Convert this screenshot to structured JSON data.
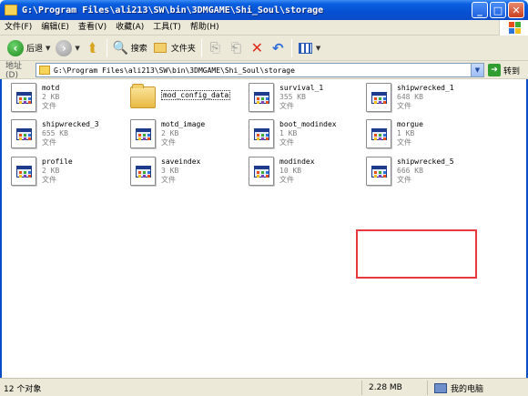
{
  "window": {
    "title": "G:\\Program Files\\ali213\\SW\\bin\\3DMGAME\\Shi_Soul\\storage",
    "controls": {
      "minimize": "_",
      "maximize": "□",
      "close": "✕"
    }
  },
  "menu": [
    "文件(F)",
    "编辑(E)",
    "查看(V)",
    "收藏(A)",
    "工具(T)",
    "帮助(H)"
  ],
  "toolbar": {
    "back_label": "后退",
    "search_label": "搜索",
    "folders_label": "文件夹"
  },
  "address": {
    "label": "地址(D)",
    "value": "G:\\Program Files\\ali213\\SW\\bin\\3DMGAME\\Shi_Soul\\storage",
    "go_label": "转到"
  },
  "files": [
    {
      "name": "motd",
      "size": "2 KB",
      "type": "文件",
      "kind": "file"
    },
    {
      "name": "mod_config_data",
      "size": "",
      "type": "",
      "kind": "folder"
    },
    {
      "name": "survival_1",
      "size": "355 KB",
      "type": "文件",
      "kind": "file"
    },
    {
      "name": "shipwrecked_1",
      "size": "648 KB",
      "type": "文件",
      "kind": "file"
    },
    {
      "name": "shipwrecked_3",
      "size": "655 KB",
      "type": "文件",
      "kind": "file"
    },
    {
      "name": "motd_image",
      "size": "2 KB",
      "type": "文件",
      "kind": "file"
    },
    {
      "name": "boot_modindex",
      "size": "1 KB",
      "type": "文件",
      "kind": "file"
    },
    {
      "name": "morgue",
      "size": "1 KB",
      "type": "文件",
      "kind": "file"
    },
    {
      "name": "profile",
      "size": "2 KB",
      "type": "文件",
      "kind": "file"
    },
    {
      "name": "saveindex",
      "size": "3 KB",
      "type": "文件",
      "kind": "file"
    },
    {
      "name": "modindex",
      "size": "10 KB",
      "type": "文件",
      "kind": "file"
    },
    {
      "name": "shipwrecked_5",
      "size": "666 KB",
      "type": "文件",
      "kind": "file"
    }
  ],
  "status": {
    "count": "12 个对象",
    "size": "2.28 MB",
    "location": "我的电脑"
  },
  "colors": {
    "titlebar": "#0651d3",
    "highlight": "#e8383d",
    "chrome": "#ece9d8"
  }
}
